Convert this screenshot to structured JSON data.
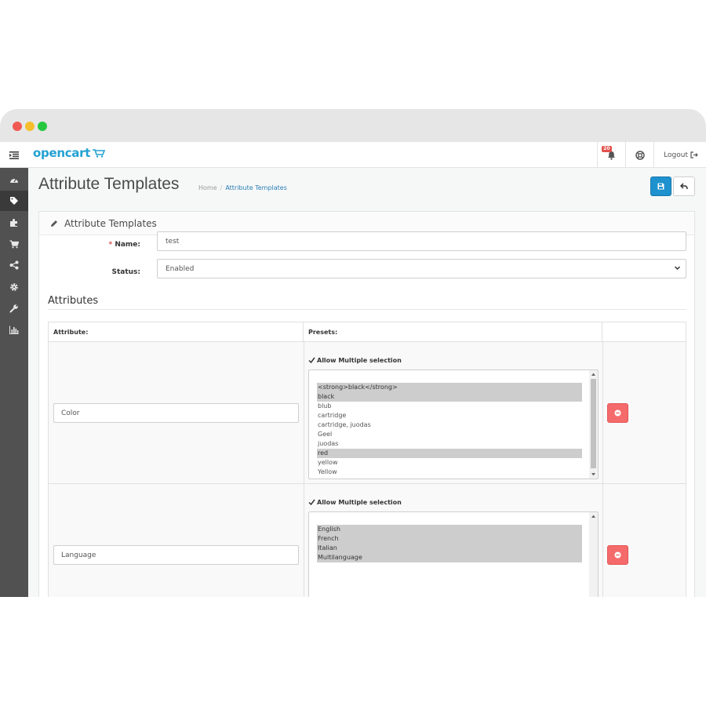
{
  "app": {
    "logo_text": "opencart",
    "notification_count": "20",
    "logout_label": "Logout"
  },
  "sidebar": {
    "items": [
      {
        "icon": "dashboard-icon"
      },
      {
        "icon": "tags-icon",
        "active": true
      },
      {
        "icon": "puzzle-icon"
      },
      {
        "icon": "cart-icon"
      },
      {
        "icon": "share-icon"
      },
      {
        "icon": "gear-icon"
      },
      {
        "icon": "wrench-icon"
      },
      {
        "icon": "chart-icon"
      }
    ]
  },
  "header": {
    "title": "Attribute Templates",
    "breadcrumb": {
      "home": "Home",
      "sep": "/",
      "current": "Attribute Templates"
    }
  },
  "panel": {
    "title": "Attribute Templates"
  },
  "form": {
    "name_label": "Name:",
    "name_value": "test",
    "status_label": "Status:",
    "status_value": "Enabled"
  },
  "attributes": {
    "section_title": "Attributes",
    "col_attribute": "Attribute:",
    "col_presets": "Presets:",
    "rows": [
      {
        "attribute": "Color",
        "allow_label": "Allow Multiple selection",
        "options": [
          "<strong>black</strong>",
          "black",
          "blub",
          "cartridge",
          "cartridge, juodas",
          "Geel",
          "juodas",
          "red",
          "yellow",
          "Yellow"
        ]
      },
      {
        "attribute": "Language",
        "allow_label": "Allow Multiple selection",
        "options": [
          "English",
          "French",
          "Italian",
          "Multilanguage"
        ]
      }
    ]
  }
}
